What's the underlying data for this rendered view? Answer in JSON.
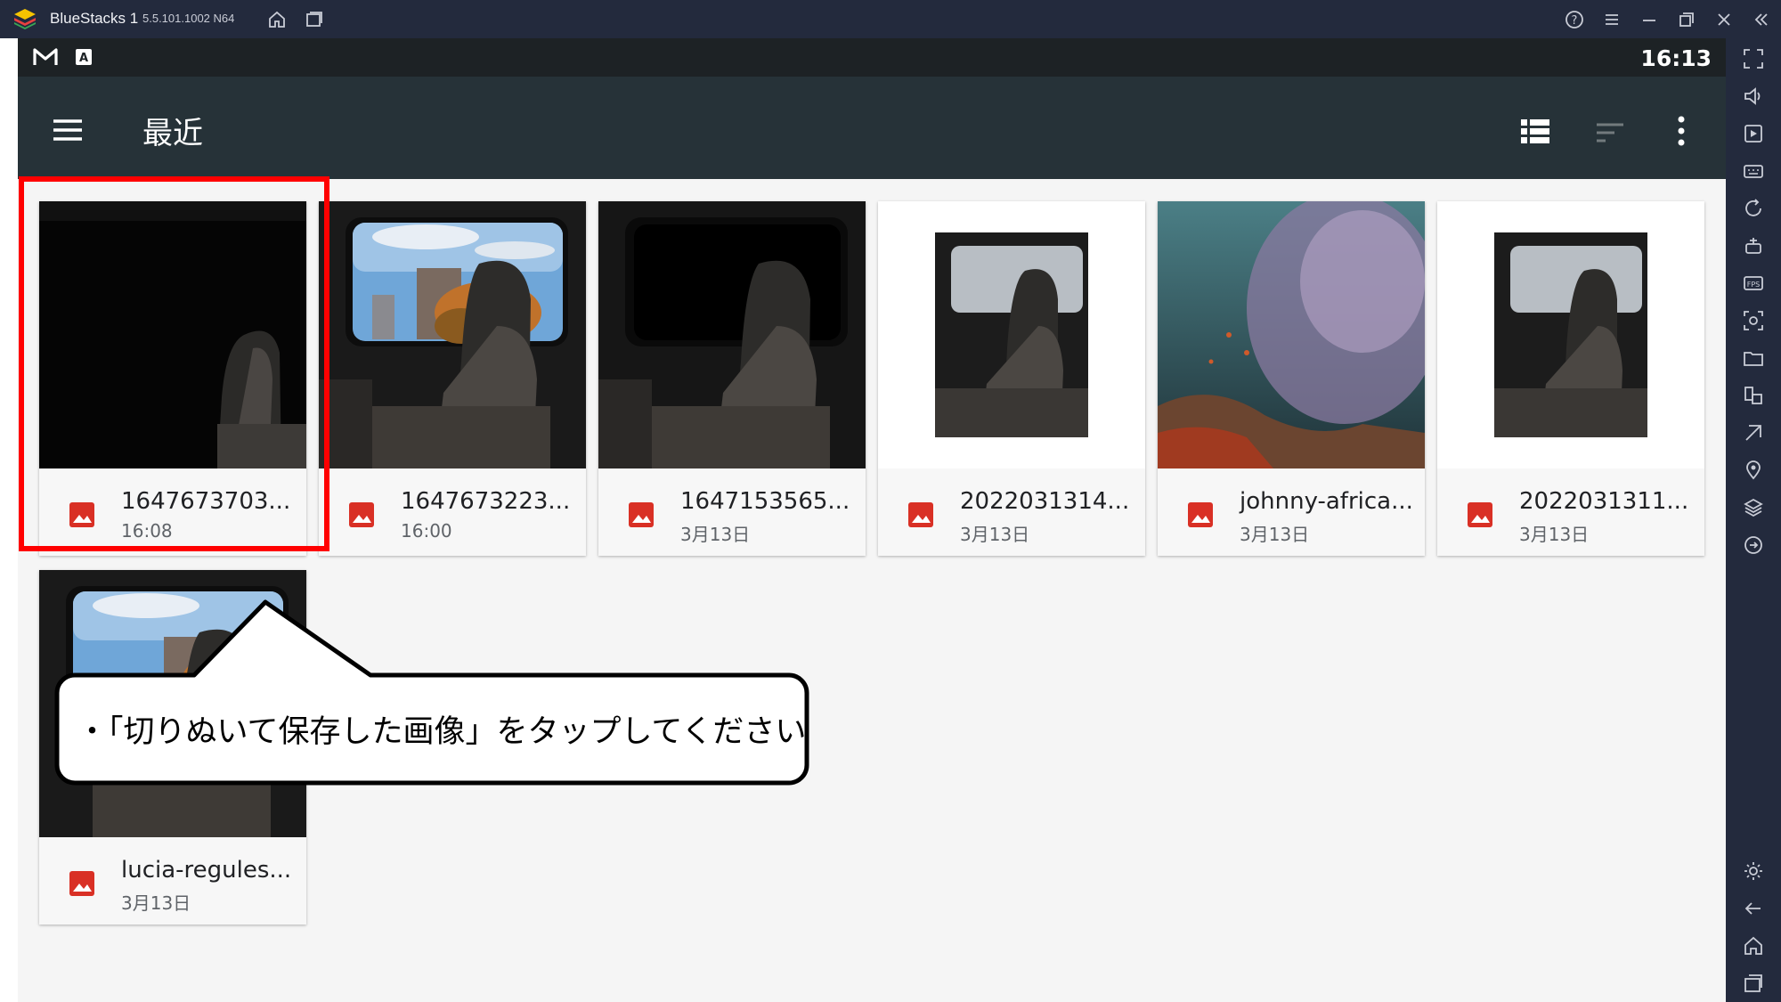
{
  "window": {
    "app_name": "BlueStacks 1",
    "version": "5.5.101.1002 N64"
  },
  "status_bar": {
    "time": "16:13"
  },
  "app_bar": {
    "title": "最近"
  },
  "files": [
    {
      "name": "1647673703...",
      "date": "16:08"
    },
    {
      "name": "1647673223...",
      "date": "16:00"
    },
    {
      "name": "1647153565...",
      "date": "3月13日"
    },
    {
      "name": "2022031314...",
      "date": "3月13日"
    },
    {
      "name": "johnny-africa...",
      "date": "3月13日"
    },
    {
      "name": "2022031311...",
      "date": "3月13日"
    },
    {
      "name": "lucia-regules...",
      "date": "3月13日"
    }
  ],
  "callout": {
    "text": "・「切りぬいて保存した画像」をタップしてください"
  },
  "colors": {
    "titlebar": "#232a3d",
    "app_bar": "#263238",
    "highlight": "#ff0000",
    "file_icon": "#d93025"
  }
}
